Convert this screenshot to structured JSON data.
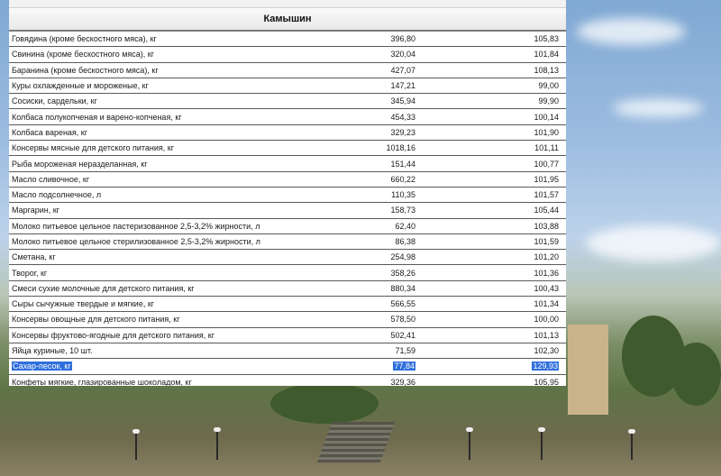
{
  "table": {
    "city": "Камышин",
    "rows": [
      {
        "name": "Говядина (кроме бескостного мяса), кг",
        "price": "396,80",
        "index": "105,83"
      },
      {
        "name": "Свинина (кроме бескостного мяса), кг",
        "price": "320,04",
        "index": "101,84"
      },
      {
        "name": "Баранина (кроме бескостного мяса), кг",
        "price": "427,07",
        "index": "108,13"
      },
      {
        "name": "Куры охлажденные и мороженые, кг",
        "price": "147,21",
        "index": "99,00"
      },
      {
        "name": "Сосиски, сардельки, кг",
        "price": "345,94",
        "index": "99,90"
      },
      {
        "name": "Колбаса полукопченая и варено-копченая, кг",
        "price": "454,33",
        "index": "100,14"
      },
      {
        "name": "Колбаса вареная, кг",
        "price": "329,23",
        "index": "101,90"
      },
      {
        "name": "Консервы мясные для детского питания, кг",
        "price": "1018,16",
        "index": "101,11"
      },
      {
        "name": "Рыба мороженая неразделанная, кг",
        "price": "151,44",
        "index": "100,77"
      },
      {
        "name": "Масло сливочное, кг",
        "price": "660,22",
        "index": "101,95"
      },
      {
        "name": "Масло подсолнечное, л",
        "price": "110,35",
        "index": "101,57"
      },
      {
        "name": "Маргарин, кг",
        "price": "158,73",
        "index": "105,44"
      },
      {
        "name": "Молоко питьевое цельное пастеризованное 2,5-3,2% жирности, л",
        "price": "62,40",
        "index": "103,88"
      },
      {
        "name": "Молоко питьевое цельное стерилизованное 2,5-3,2% жирности, л",
        "price": "86,38",
        "index": "101,59"
      },
      {
        "name": "Сметана, кг",
        "price": "254,98",
        "index": "101,20"
      },
      {
        "name": "Творог, кг",
        "price": "358,26",
        "index": "101,36"
      },
      {
        "name": "Смеси сухие молочные для детского питания, кг",
        "price": "880,34",
        "index": "100,43"
      },
      {
        "name": "Сыры сычужные твердые и мягкие, кг",
        "price": "566,55",
        "index": "101,34"
      },
      {
        "name": "Консервы овощные для детского питания, кг",
        "price": "578,50",
        "index": "100,00"
      },
      {
        "name": "Консервы фруктово-ягодные для детского питания, кг",
        "price": "502,41",
        "index": "101,13"
      },
      {
        "name": "Яйца куриные, 10 шт.",
        "price": "71,59",
        "index": "102,30"
      },
      {
        "name": "Сахар-песок, кг",
        "price": "77,84",
        "index": "129,93"
      },
      {
        "name": "Конфеты мягкие, глазированные шоколадом, кг",
        "price": "329,36",
        "index": "105,95"
      }
    ]
  },
  "colors": {
    "selection": "#2f6fdd"
  }
}
